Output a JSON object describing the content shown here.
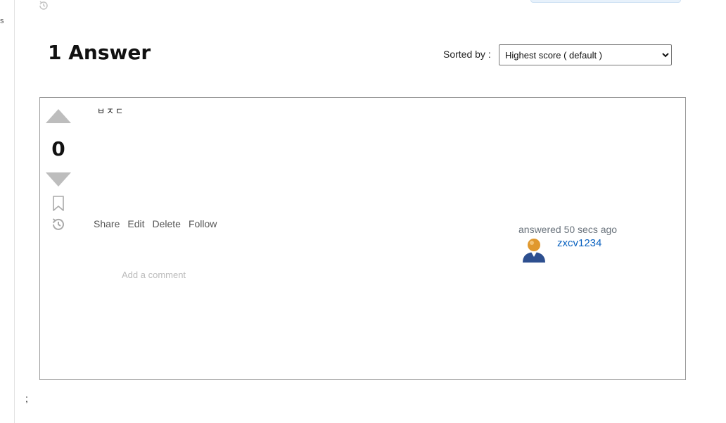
{
  "page": {
    "left_fragment": "s",
    "footer_semicolon": ";"
  },
  "answers": {
    "title": "1 Answer",
    "sort": {
      "label": "Sorted by :",
      "selected": "Highest score ( default )"
    }
  },
  "answer": {
    "score": "0",
    "body": "ㅂㅈㄷ",
    "actions": [
      "Share",
      "Edit",
      "Delete",
      "Follow"
    ],
    "answered_text": "answered 50 secs ago",
    "user_name": "zxcv1234",
    "add_comment": "Add a comment"
  },
  "colors": {
    "link": "#0a62c0",
    "vote_arrow": "#bdbdbd",
    "border": "#999999"
  }
}
